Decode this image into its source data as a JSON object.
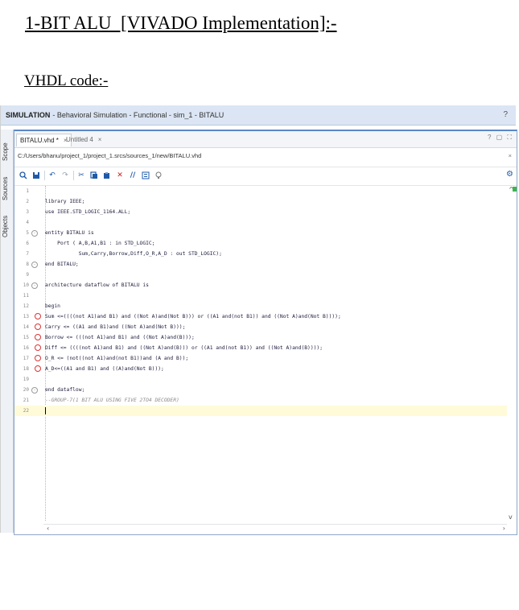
{
  "document": {
    "heading": "1-BIT ALU  [VIVADO Implementation]:-",
    "subheading": "VHDL code:-"
  },
  "simulation_bar": {
    "title": "SIMULATION",
    "subtitle": "- Behavioral Simulation - Functional - sim_1 - BITALU",
    "help": "?"
  },
  "left_rail": {
    "tabs": [
      "Scope",
      "Sources",
      "Objects"
    ]
  },
  "editor": {
    "tabs": [
      {
        "label": "BITALU.vhd *",
        "close": "×"
      },
      {
        "label": "Untitled 4",
        "close": "×"
      }
    ],
    "tab_controls": "? ▢ ⛶",
    "file_path": "C:/Users/bhanu/project_1/project_1.srcs/sources_1/new/BITALU.vhd",
    "path_close": "×",
    "toolbar_icons": [
      "search-icon",
      "save-icon",
      "undo-icon",
      "redo-icon",
      "cut-icon",
      "copy-icon",
      "paste-icon",
      "delete-icon",
      "comment-icon",
      "format-icon",
      "bulb-icon"
    ],
    "code_lines": [
      {
        "n": "1",
        "text": "",
        "fold": false,
        "bp": false
      },
      {
        "n": "2",
        "text": "library IEEE;",
        "fold": false,
        "bp": false
      },
      {
        "n": "3",
        "text": "use IEEE.STD_LOGIC_1164.ALL;",
        "fold": false,
        "bp": false
      },
      {
        "n": "4",
        "text": "",
        "fold": false,
        "bp": false
      },
      {
        "n": "5",
        "text": "entity BITALU is",
        "fold": true,
        "bp": false
      },
      {
        "n": "6",
        "text": "    Port ( A,B,A1,B1 : in STD_LOGIC;",
        "fold": false,
        "bp": false
      },
      {
        "n": "7",
        "text": "           Sum,Carry,Borrow,Diff,O_R,A_D : out STD_LOGIC);",
        "fold": false,
        "bp": false
      },
      {
        "n": "8",
        "text": "end BITALU;",
        "fold": true,
        "bp": false
      },
      {
        "n": "9",
        "text": "",
        "fold": false,
        "bp": false
      },
      {
        "n": "10",
        "text": "architecture dataflow of BITALU is",
        "fold": true,
        "bp": false
      },
      {
        "n": "11",
        "text": "",
        "fold": false,
        "bp": false
      },
      {
        "n": "12",
        "text": "begin",
        "fold": false,
        "bp": false
      },
      {
        "n": "13",
        "text": "Sum <=((((not A1)and B1) and ((Not A)and(Not B))) or ((A1 and(not B1)) and ((Not A)and(Not B))));",
        "fold": false,
        "bp": true
      },
      {
        "n": "14",
        "text": "Carry <= ((A1 and B1)and ((Not A)and(Not B)));",
        "fold": false,
        "bp": true
      },
      {
        "n": "15",
        "text": "Borrow <= (((not A1)and B1) and ((Not A)and(B)));",
        "fold": false,
        "bp": true
      },
      {
        "n": "16",
        "text": "Diff <= ((((not A1)and B1) and ((Not A)and(B))) or ((A1 and(not B1)) and ((Not A)and(B))));",
        "fold": false,
        "bp": true
      },
      {
        "n": "17",
        "text": "O_R <= (not((not A1)and(not B1))and (A and B));",
        "fold": false,
        "bp": true
      },
      {
        "n": "18",
        "text": "A_D<=((A1 and B1) and ((A)and(Not B)));",
        "fold": false,
        "bp": true
      },
      {
        "n": "19",
        "text": "",
        "fold": false,
        "bp": false
      },
      {
        "n": "20",
        "text": "end dataflow;",
        "fold": true,
        "bp": false
      },
      {
        "n": "21",
        "text": "--GROUP-7(1 BIT ALU USING FIVE 2TO4 DECODER)",
        "fold": false,
        "bp": false,
        "comment": true
      },
      {
        "n": "22",
        "text": "",
        "fold": false,
        "bp": false,
        "current": true
      }
    ],
    "scroll_left": "‹",
    "scroll_right": "›",
    "scroll_up": "^",
    "scroll_down": "v",
    "settings_icon": "gear-icon"
  }
}
